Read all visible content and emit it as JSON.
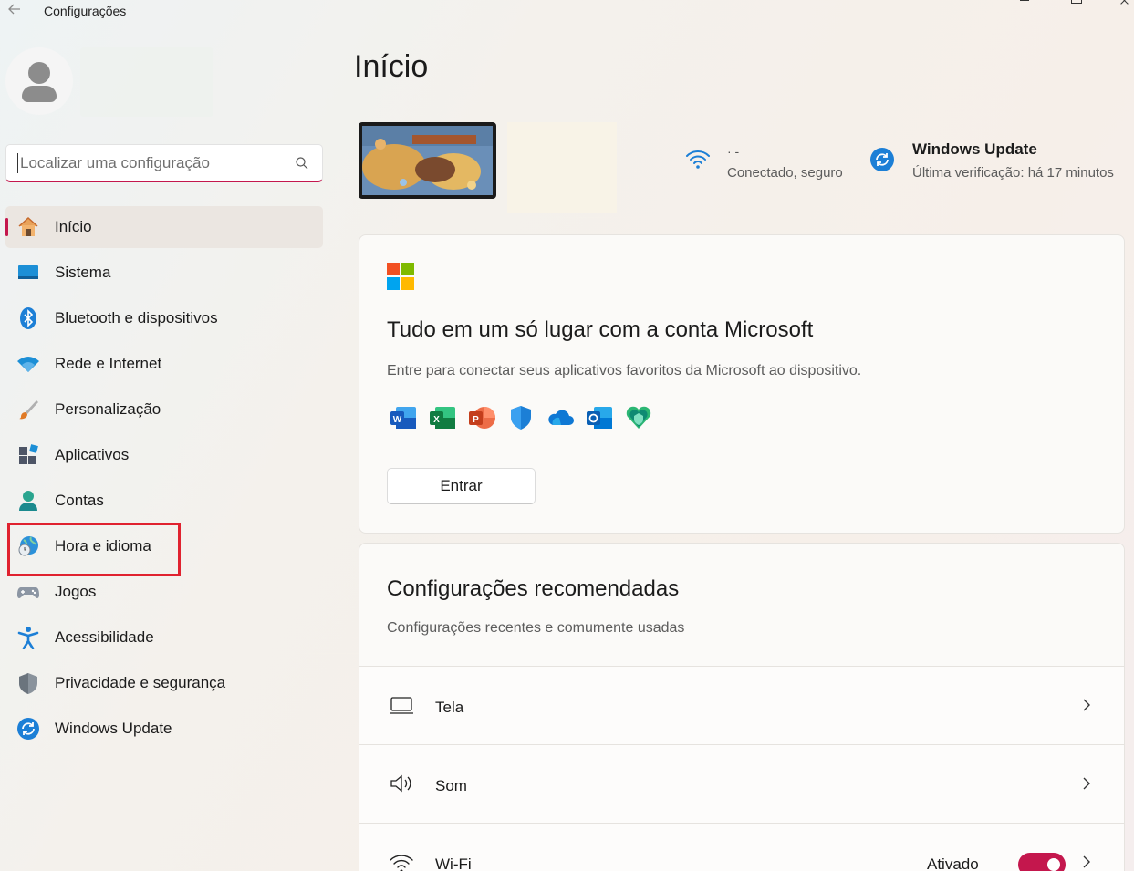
{
  "window": {
    "title": "Configurações"
  },
  "search": {
    "placeholder": "Localizar uma configuração"
  },
  "sidebar": {
    "items": [
      {
        "label": "Início",
        "icon": "home-icon"
      },
      {
        "label": "Sistema",
        "icon": "monitor-icon"
      },
      {
        "label": "Bluetooth e dispositivos",
        "icon": "bluetooth-icon"
      },
      {
        "label": "Rede e Internet",
        "icon": "wifi-icon"
      },
      {
        "label": "Personalização",
        "icon": "paintbrush-icon"
      },
      {
        "label": "Aplicativos",
        "icon": "apps-icon"
      },
      {
        "label": "Contas",
        "icon": "person-icon"
      },
      {
        "label": "Hora e idioma",
        "icon": "globe-clock-icon"
      },
      {
        "label": "Jogos",
        "icon": "gamepad-icon"
      },
      {
        "label": "Acessibilidade",
        "icon": "accessibility-icon"
      },
      {
        "label": "Privacidade e segurança",
        "icon": "shield-icon"
      },
      {
        "label": "Windows Update",
        "icon": "update-icon"
      }
    ],
    "active_index": 0,
    "highlighted_index": 7
  },
  "main": {
    "title": "Início",
    "network": {
      "name": "· -",
      "status": "Conectado, seguro"
    },
    "windows_update": {
      "title": "Windows Update",
      "subtitle": "Última verificação: há 17 minutos"
    },
    "ms_account_card": {
      "title": "Tudo em um só lugar com a conta Microsoft",
      "subtitle": "Entre para conectar seus aplicativos favoritos da Microsoft ao dispositivo.",
      "app_icons": [
        "word-icon",
        "excel-icon",
        "powerpoint-icon",
        "defender-icon",
        "onedrive-icon",
        "outlook-icon",
        "family-safety-icon"
      ],
      "signin_label": "Entrar"
    },
    "recommended": {
      "title": "Configurações recomendadas",
      "subtitle": "Configurações recentes e comumente usadas",
      "rows": [
        {
          "label": "Tela",
          "icon": "display-icon"
        },
        {
          "label": "Som",
          "icon": "speaker-icon"
        },
        {
          "label": "Wi-Fi",
          "icon": "wifi-icon",
          "toggle_label": "Ativado",
          "toggle_on": true
        }
      ]
    }
  },
  "colors": {
    "accent": "#c4174d",
    "highlight_box": "#e0222f"
  }
}
